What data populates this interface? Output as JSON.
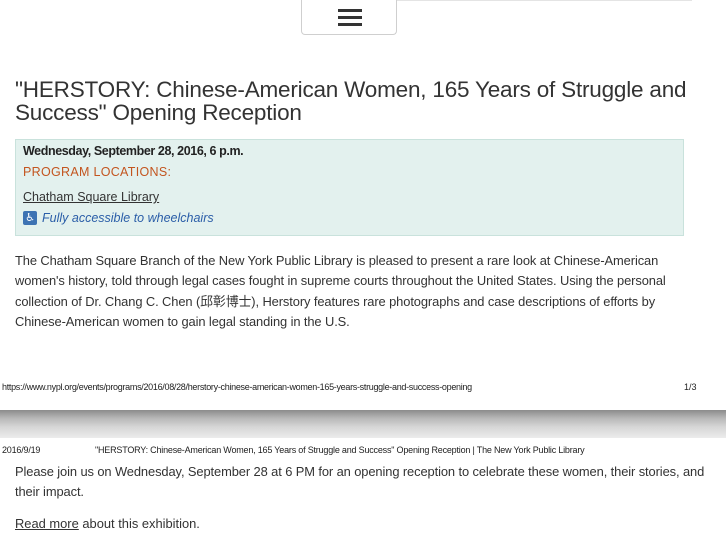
{
  "event": {
    "title": "\"HERSTORY: Chinese-American Women, 165 Years of Struggle and Success\" Opening Reception",
    "date": "Wednesday, September 28, 2016, 6 p.m.",
    "locations_label": "PROGRAM LOCATIONS:",
    "location": "Chatham Square Library",
    "accessibility": "Fully accessible to wheelchairs",
    "description": "The Chatham Square Branch of the New York Public Library is pleased to present a rare look at Chinese-American women's history, told through legal cases fought in supreme courts throughout the United States. Using the personal collection of Dr. Chang C. Chen (邱彰博士), Herstory features rare photographs and case descriptions of efforts by Chinese-American women to gain legal standing in the U.S.",
    "invitation": "Please join us on Wednesday, September 28 at 6 PM for an opening reception to celebrate these women, their stories, and their impact.",
    "read_more_link": "Read more",
    "read_more_tail": " about this exhibition."
  },
  "print_footer": {
    "url": "https://www.nypl.org/events/programs/2016/08/28/herstory-chinese-american-women-165-years-struggle-and-success-opening",
    "page": "1/3"
  },
  "print_header": {
    "date": "2016/9/19",
    "title": "\"HERSTORY: Chinese-American Women, 165 Years of Struggle and Success\" Opening Reception | The New York Public Library"
  },
  "colors": {
    "info_bg": "#e3f1ee",
    "location_label": "#c3551f",
    "accessibility_link": "#2b5ea8"
  },
  "icons": {
    "menu": "hamburger-menu-icon",
    "accessibility": "wheelchair-icon"
  }
}
